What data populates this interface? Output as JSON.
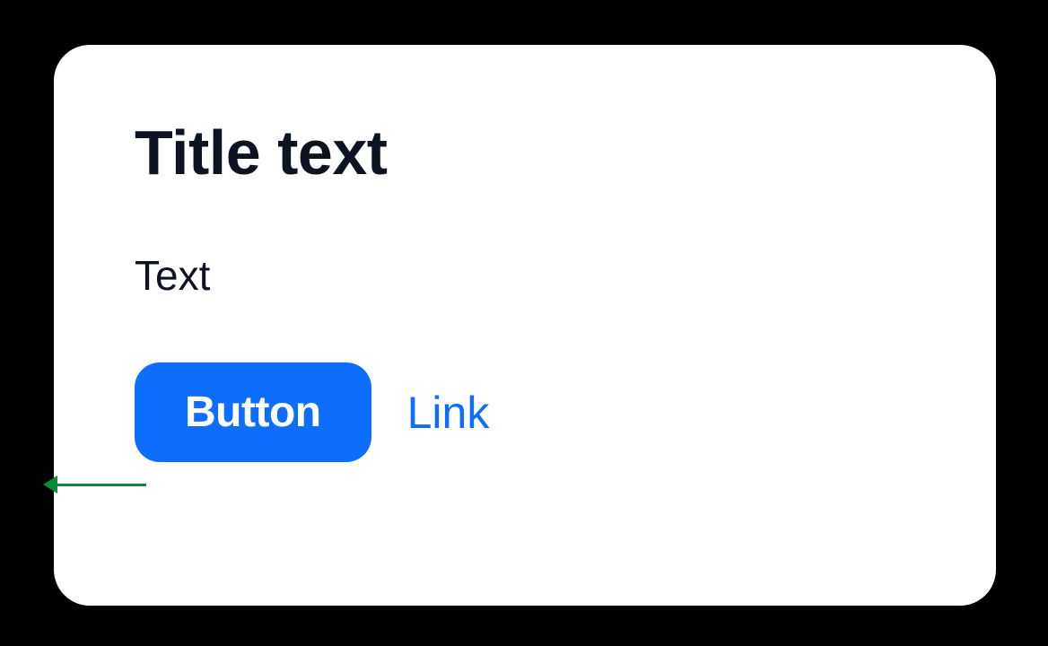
{
  "card": {
    "title": "Title text",
    "body": "Text",
    "button_label": "Button",
    "link_label": "Link"
  },
  "colors": {
    "background": "#000000",
    "card_bg": "#ffffff",
    "title_text": "#0d1321",
    "body_text": "#0d1321",
    "button_bg": "#0d6efd",
    "button_text": "#ffffff",
    "link_text": "#0d6efd",
    "annotation": "#0a8a3a"
  }
}
